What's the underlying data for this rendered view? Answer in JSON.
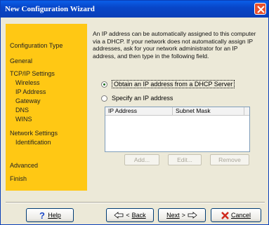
{
  "window": {
    "title": "New Configuration Wizard"
  },
  "sidebar": {
    "items": [
      {
        "label": "Configuration Type"
      },
      {
        "label": "General"
      },
      {
        "label": "TCP/IP Settings"
      },
      {
        "label": "Wireless"
      },
      {
        "label": "IP Address"
      },
      {
        "label": "Gateway"
      },
      {
        "label": "DNS"
      },
      {
        "label": "WINS"
      },
      {
        "label": "Network Settings"
      },
      {
        "label": "Identification"
      },
      {
        "label": "Advanced"
      },
      {
        "label": "Finish"
      }
    ]
  },
  "main": {
    "description": "An IP address can be automatically assigned to this computer via a DHCP. If your network does not automatically assign IP addresses, ask for your network administrator for an IP address, and then type in the following field.",
    "radio_dhcp": {
      "label": "Obtain an IP address from a DHCP Server",
      "checked": true
    },
    "radio_specify": {
      "label": "Specify an IP address",
      "checked": false
    },
    "list": {
      "col1": "IP Address",
      "col2": "Subnet Mask"
    },
    "buttons": {
      "add": "Add...",
      "edit": "Edit...",
      "remove": "Remove"
    }
  },
  "footer": {
    "help": "Help",
    "back": "Back",
    "next": "Next",
    "cancel": "Cancel"
  },
  "colors": {
    "sidebar": "#ffc814",
    "titlebar": "#0a46c8",
    "close": "#e8502c"
  },
  "icons": [
    "close-icon",
    "help-icon",
    "back-arrow-icon",
    "next-arrow-icon",
    "cancel-x-icon"
  ]
}
